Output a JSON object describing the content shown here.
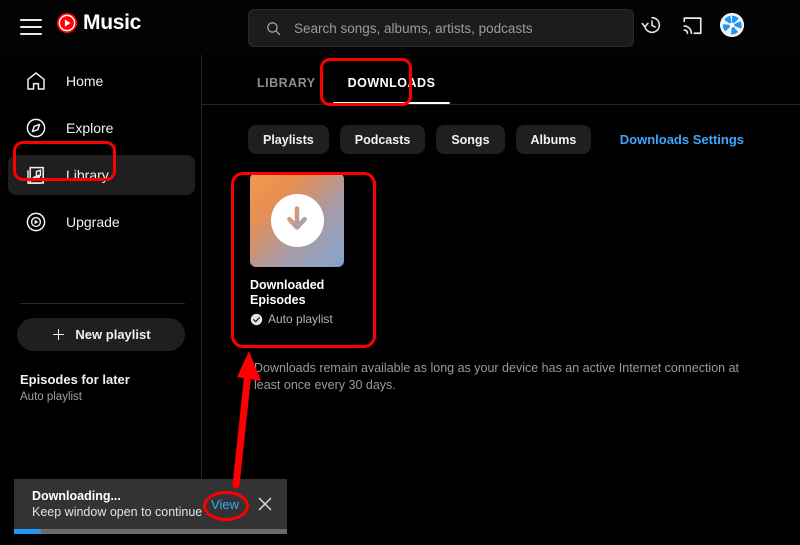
{
  "app": {
    "brand": "Music",
    "logo_color": "#ff0000"
  },
  "topbar": {
    "menu_label": "Menu",
    "search": {
      "placeholder": "Search songs, albums, artists, podcasts",
      "value": ""
    },
    "icons": [
      {
        "name": "history-icon",
        "label": "History"
      },
      {
        "name": "cast-icon",
        "label": "Cast"
      },
      {
        "name": "avatar",
        "label": "Account"
      }
    ]
  },
  "sidebar": {
    "items": [
      {
        "label": "Home",
        "icon": "home-icon",
        "active": false
      },
      {
        "label": "Explore",
        "icon": "compass-icon",
        "active": false
      },
      {
        "label": "Library",
        "icon": "library-icon",
        "active": true
      },
      {
        "label": "Upgrade",
        "icon": "upgrade-icon",
        "active": false
      }
    ],
    "new_playlist": "New playlist",
    "episodes_for_later": {
      "title": "Episodes for later",
      "subtitle": "Auto playlist"
    }
  },
  "main": {
    "tabs": [
      {
        "label": "LIBRARY",
        "active": false
      },
      {
        "label": "DOWNLOADS",
        "active": true
      }
    ],
    "chips": [
      "Playlists",
      "Podcasts",
      "Songs",
      "Albums"
    ],
    "downloads_settings": "Downloads Settings",
    "card": {
      "title": "Downloaded Episodes",
      "subtitle": "Auto playlist",
      "badge_icon": "check-circle-icon",
      "thumb_icon": "download-arrow-icon"
    },
    "note": "Downloads remain available as long as your device has an active Internet connection at least once every 30 days."
  },
  "toast": {
    "title": "Downloading...",
    "message": "Keep window open to continue",
    "action": "View",
    "close_icon": "close-icon",
    "progress_percent": 10
  },
  "annotations": {
    "accent": "#fe0000",
    "highlights": [
      "library-nav-item",
      "downloads-tab",
      "downloaded-episodes-card",
      "view-link"
    ],
    "arrow": "points-from-toast-to-downloads-card"
  },
  "colors": {
    "background": "#000000",
    "surface": "#1f1f1f",
    "link": "#3ea6ff",
    "text_primary": "#ffffff",
    "text_secondary": "#9a9a9a",
    "progress": "#2196f3"
  }
}
